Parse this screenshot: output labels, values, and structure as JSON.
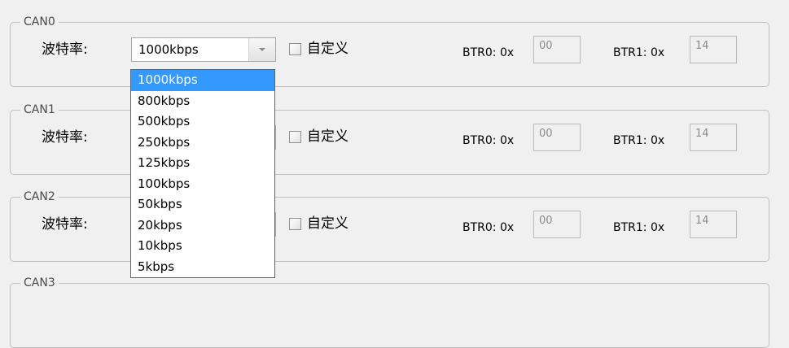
{
  "groups": [
    {
      "title": "CAN0",
      "rate_label": "波特率:",
      "rate_value": "1000kbps",
      "custom_label": "自定义",
      "btr0_label": "BTR0: 0x",
      "btr0_value": "00",
      "btr1_label": "BTR1: 0x",
      "btr1_value": "14"
    },
    {
      "title": "CAN1",
      "rate_label": "波特率:",
      "rate_value": "",
      "custom_label": "自定义",
      "btr0_label": "BTR0: 0x",
      "btr0_value": "00",
      "btr1_label": "BTR1: 0x",
      "btr1_value": "14"
    },
    {
      "title": "CAN2",
      "rate_label": "波特率:",
      "rate_value": "",
      "custom_label": "自定义",
      "btr0_label": "BTR0: 0x",
      "btr0_value": "00",
      "btr1_label": "BTR1: 0x",
      "btr1_value": "14"
    },
    {
      "title": "CAN3"
    }
  ],
  "dropdown": {
    "selected": "1000kbps",
    "options": [
      "1000kbps",
      "800kbps",
      "500kbps",
      "250kbps",
      "125kbps",
      "100kbps",
      "50kbps",
      "20kbps",
      "10kbps",
      "5kbps"
    ]
  },
  "colors": {
    "selection": "#3399ff",
    "group_border": "#bfbfbf",
    "window_bg": "#f0f0f0"
  }
}
